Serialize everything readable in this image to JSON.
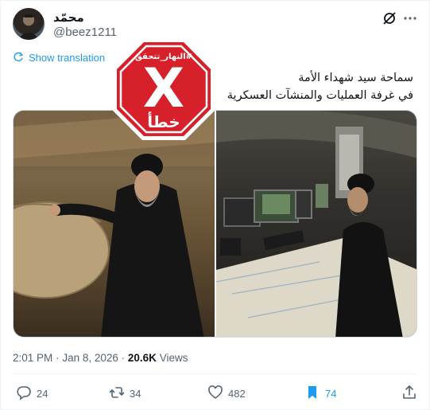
{
  "author": {
    "name": "محمّد",
    "handle": "@beez1211"
  },
  "translate_label": "Show translation",
  "tweet_lines": [
    "سماحة سيد شهداء الأمة",
    "في غرفة العمليات والمنشآت العسكرية"
  ],
  "stamp": {
    "hashtag": "#النهار_تتحقق",
    "mark": "X",
    "verdict": "خطأ"
  },
  "meta": {
    "time": "2:01 PM",
    "separator": "·",
    "date": "Jan 8, 2026",
    "views_count": "20.6K",
    "views_label": "Views"
  },
  "actions": {
    "replies": "24",
    "reposts": "34",
    "likes": "482",
    "bookmarks": "74"
  },
  "colors": {
    "accent": "#1d9bf0",
    "stamp_red": "#d6202a",
    "muted": "#536471"
  }
}
